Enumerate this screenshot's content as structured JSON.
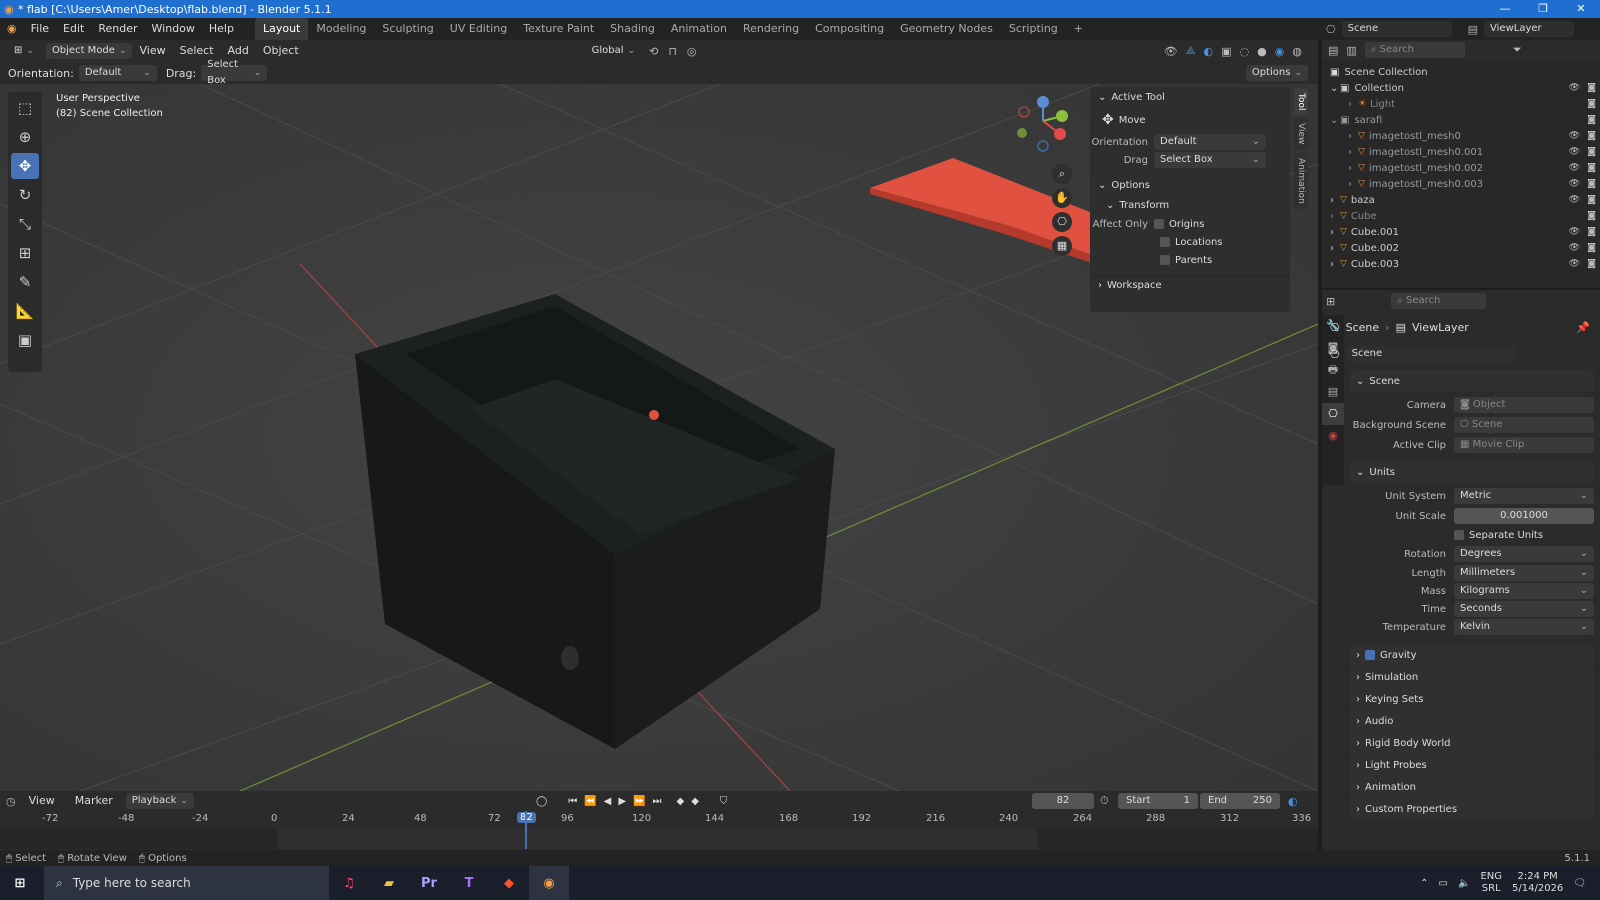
{
  "titlebar": {
    "title": "* flab [C:\\Users\\Amer\\Desktop\\flab.blend] - Blender 5.1.1"
  },
  "menu": {
    "items": [
      "File",
      "Edit",
      "Render",
      "Window",
      "Help"
    ]
  },
  "workspaces": [
    "Layout",
    "Modeling",
    "Sculpting",
    "UV Editing",
    "Texture Paint",
    "Shading",
    "Animation",
    "Rendering",
    "Compositing",
    "Geometry Nodes",
    "Scripting"
  ],
  "topright": {
    "scene": "Scene",
    "viewlayer": "ViewLayer"
  },
  "viewport_header": {
    "mode": "Object Mode",
    "menus": [
      "View",
      "Select",
      "Add",
      "Object"
    ],
    "transform": "Global",
    "options": "Options"
  },
  "tool_header": {
    "orientation_label": "Orientation:",
    "orientation": "Default",
    "drag_label": "Drag:",
    "drag": "Select Box"
  },
  "overlay": {
    "line1": "User Perspective",
    "line2": "(82) Scene Collection"
  },
  "npanel": {
    "active_tool": "Active Tool",
    "move": "Move",
    "orientation_label": "Orientation",
    "orientation": "Default",
    "drag_label": "Drag",
    "drag": "Select Box",
    "options": "Options",
    "transform": "Transform",
    "affect_only": "Affect Only",
    "origins": "Origins",
    "locations": "Locations",
    "parents": "Parents",
    "workspace": "Workspace",
    "tabs": [
      "Tool",
      "View",
      "Animation"
    ]
  },
  "outliner": {
    "search": "Search",
    "root": "Scene Collection",
    "collection": "Collection",
    "light": "Light",
    "sarafi": "sarafi",
    "meshes": [
      "imagetostl_mesh0",
      "imagetostl_mesh0.001",
      "imagetostl_mesh0.002",
      "imagetostl_mesh0.003"
    ],
    "objects": [
      "baza",
      "Cube",
      "Cube.001",
      "Cube.002",
      "Cube.003"
    ]
  },
  "properties": {
    "search": "Search",
    "bc_scene": "Scene",
    "bc_viewlayer": "ViewLayer",
    "scene_field": "Scene",
    "sec_scene": "Scene",
    "camera": "Camera",
    "camera_ph": "Object",
    "bg": "Background Scene",
    "bg_ph": "Scene",
    "clip": "Active Clip",
    "clip_ph": "Movie Clip",
    "sec_units": "Units",
    "unit_system": "Unit System",
    "unit_system_v": "Metric",
    "unit_scale": "Unit Scale",
    "unit_scale_v": "0.001000",
    "separate": "Separate Units",
    "rotation": "Rotation",
    "rotation_v": "Degrees",
    "length": "Length",
    "length_v": "Millimeters",
    "mass": "Mass",
    "mass_v": "Kilograms",
    "time": "Time",
    "time_v": "Seconds",
    "temperature": "Temperature",
    "temperature_v": "Kelvin",
    "sections": [
      "Gravity",
      "Simulation",
      "Keying Sets",
      "Audio",
      "Rigid Body World",
      "Light Probes",
      "Animation",
      "Custom Properties"
    ]
  },
  "timeline": {
    "menus": [
      "View",
      "Marker",
      "Playback"
    ],
    "current": "82",
    "start_label": "Start",
    "start": "1",
    "end_label": "End",
    "end": "250",
    "ticks": [
      "-72",
      "-48",
      "-24",
      "0",
      "24",
      "48",
      "72",
      "82",
      "96",
      "120",
      "144",
      "168",
      "192",
      "216",
      "240",
      "264",
      "288",
      "312",
      "336"
    ]
  },
  "status": {
    "items": [
      "Select",
      "Rotate View",
      "Options"
    ],
    "version": "5.1.1"
  },
  "taskbar": {
    "search": "Type here to search",
    "lang1": "ENG",
    "lang2": "SRL",
    "time": "2:24 PM",
    "date": "5/14/2026"
  }
}
